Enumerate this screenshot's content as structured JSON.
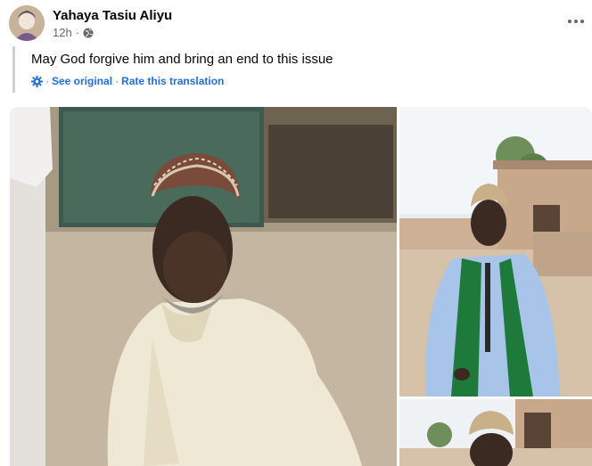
{
  "post": {
    "author": "Yahaya Tasiu Aliyu",
    "time": "12h",
    "privacy_icon": "globe-icon",
    "text": "May God forgive him and bring an end to this issue",
    "see_original": "See original",
    "separator": "·",
    "rate_translation": "Rate this translation",
    "options_icon": "more-options-icon"
  },
  "photos": [
    {
      "name": "photo-main"
    },
    {
      "name": "photo-right-top"
    },
    {
      "name": "photo-right-bottom"
    }
  ],
  "colors": {
    "link": "#216fdb",
    "secondary_text": "#65676b",
    "primary_text": "#050505",
    "quote_bar": "#ced0d4"
  }
}
